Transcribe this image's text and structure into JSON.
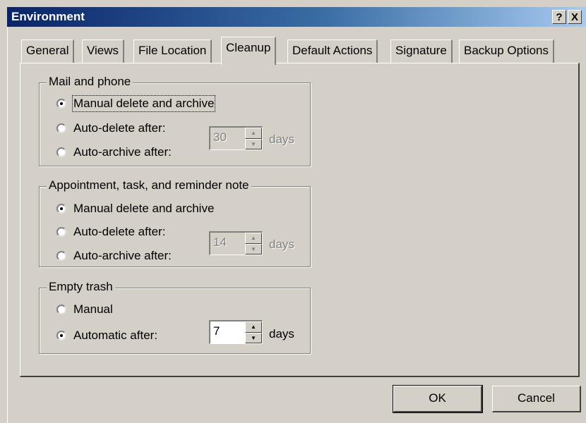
{
  "window": {
    "title": "Environment",
    "help_label": "?",
    "close_label": "X"
  },
  "tabs": [
    "General",
    "Views",
    "File Location",
    "Cleanup",
    "Default Actions",
    "Signature",
    "Backup Options"
  ],
  "active_tab": "Cleanup",
  "mail_phone": {
    "legend": "Mail and phone",
    "option_manual": "Manual delete and archive",
    "option_auto_delete": "Auto-delete after:",
    "option_auto_archive": "Auto-archive after:",
    "selected": "Manual delete and archive",
    "days_value": "30",
    "days_label": "days"
  },
  "appointment": {
    "legend": "Appointment, task, and reminder note",
    "option_manual": "Manual delete and archive",
    "option_auto_delete": "Auto-delete after:",
    "option_auto_archive": "Auto-archive after:",
    "selected": "Manual delete and archive",
    "days_value": "14",
    "days_label": "days"
  },
  "empty_trash": {
    "legend": "Empty trash",
    "option_manual": "Manual",
    "option_automatic": "Automatic after:",
    "selected": "Automatic after:",
    "days_value": "7",
    "days_label": "days"
  },
  "buttons": {
    "ok": "OK",
    "cancel": "Cancel"
  }
}
